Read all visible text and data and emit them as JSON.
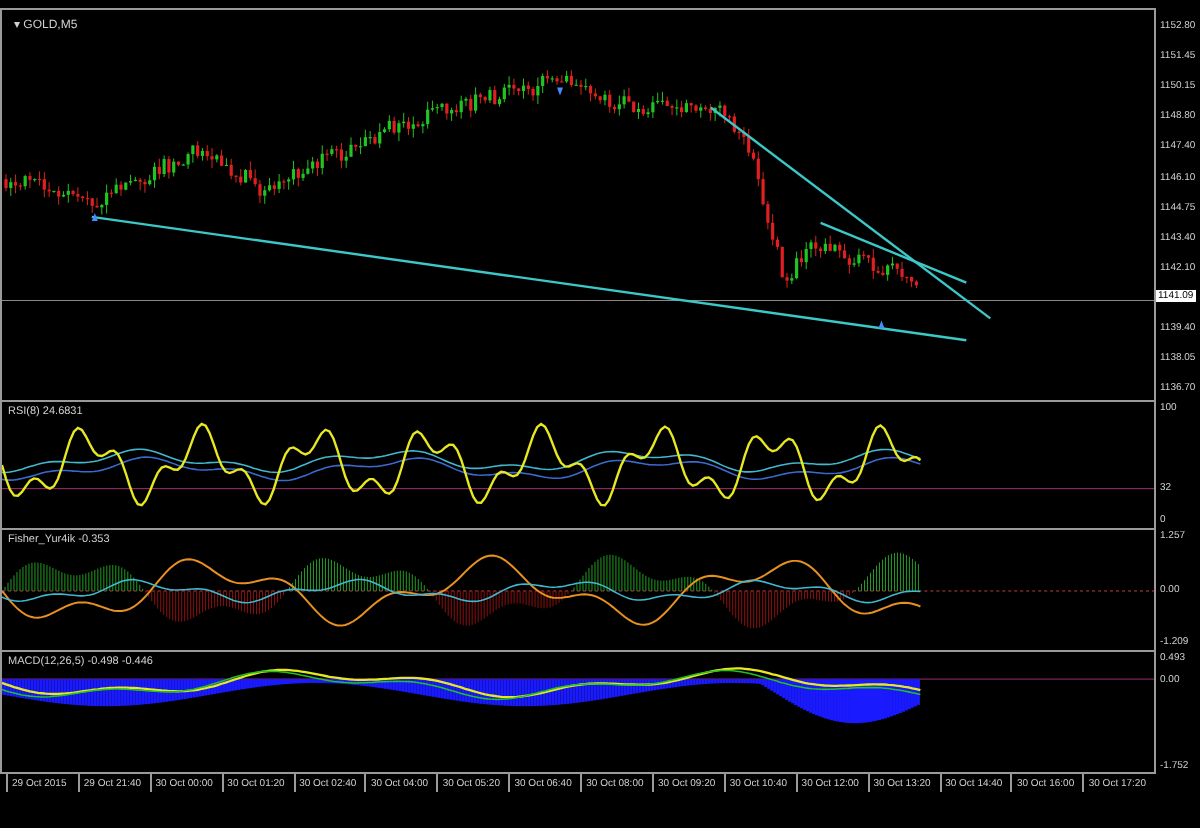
{
  "chart": {
    "menu_arrow": "▾",
    "title": "GOLD,M5",
    "current_price": "1141.09"
  },
  "price_axis": [
    "1152.80",
    "1151.45",
    "1150.15",
    "1148.80",
    "1147.40",
    "1146.10",
    "1144.75",
    "1143.40",
    "1142.10",
    "1139.40",
    "1138.05",
    "1136.70"
  ],
  "indicators": [
    {
      "kind": "rsi",
      "label": "RSI(8) 24.6831",
      "axis": [
        "100",
        "32",
        "0"
      ]
    },
    {
      "kind": "fisher",
      "label": "Fisher_Yur4ik -0.353",
      "axis": [
        "1.257",
        "0.00",
        "-1.209"
      ]
    },
    {
      "kind": "macd",
      "label": "MACD(12,26,5) -0.498 -0.446",
      "axis": [
        "0.493",
        "0.00",
        "-1.752"
      ]
    }
  ],
  "time_axis": [
    "29 Oct 2015",
    "29 Oct 21:40",
    "30 Oct 00:00",
    "30 Oct 01:20",
    "30 Oct 02:40",
    "30 Oct 04:00",
    "30 Oct 05:20",
    "30 Oct 06:40",
    "30 Oct 08:00",
    "30 Oct 09:20",
    "30 Oct 10:40",
    "30 Oct 12:00",
    "30 Oct 13:20",
    "30 Oct 14:40",
    "30 Oct 16:00",
    "30 Oct 17:20"
  ]
}
